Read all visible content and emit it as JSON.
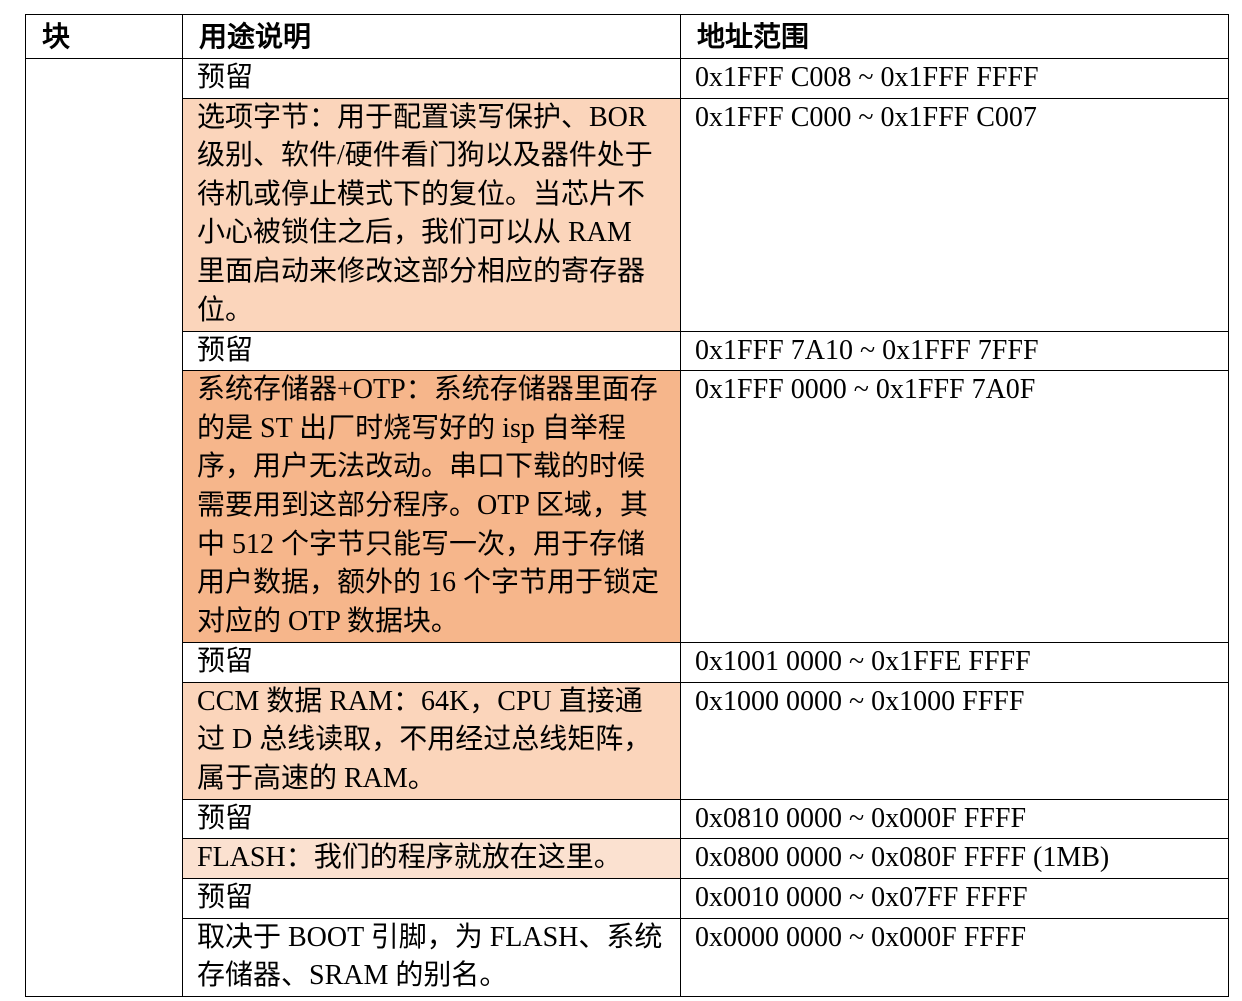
{
  "headers": {
    "block": "块",
    "purpose": "用途说明",
    "address": "地址范围"
  },
  "rows": [
    {
      "purpose": "预留",
      "address": "0x1FFF C008 ~ 0x1FFF FFFF",
      "shade": "none"
    },
    {
      "purpose": "选项字节：用于配置读写保护、BOR 级别、软件/硬件看门狗以及器件处于待机或停止模式下的复位。当芯片不小心被锁住之后，我们可以从 RAM 里面启动来修改这部分相应的寄存器位。",
      "address": "0x1FFF C000 ~ 0x1FFF C007",
      "shade": "light"
    },
    {
      "purpose": "预留",
      "address": "0x1FFF 7A10 ~ 0x1FFF 7FFF",
      "shade": "none"
    },
    {
      "purpose": "系统存储器+OTP：系统存储器里面存的是 ST 出厂时烧写好的 isp 自举程序，用户无法改动。串口下载的时候需要用到这部分程序。OTP 区域，其中 512 个字节只能写一次，用于存储用户数据，额外的 16 个字节用于锁定对应的 OTP 数据块。",
      "address": "0x1FFF 0000 ~ 0x1FFF 7A0F",
      "shade": "dark"
    },
    {
      "purpose": "预留",
      "address": "0x1001 0000 ~ 0x1FFE FFFF",
      "shade": "none"
    },
    {
      "purpose": "CCM 数据 RAM：64K，CPU 直接通过 D 总线读取，不用经过总线矩阵，属于高速的 RAM。",
      "address": "0x1000 0000 ~ 0x1000 FFFF",
      "shade": "light"
    },
    {
      "purpose": "预留",
      "address": "0x0810 0000 ~ 0x000F FFFF",
      "shade": "none"
    },
    {
      "purpose": "FLASH：我们的程序就放在这里。",
      "address": "0x0800 0000 ~ 0x080F FFFF (1MB)",
      "shade": "pale"
    },
    {
      "purpose": "预留",
      "address": "0x0010 0000 ~ 0x07FF FFFF",
      "shade": "none"
    },
    {
      "purpose": "取决于 BOOT 引脚，为 FLASH、系统存储器、SRAM 的别名。",
      "address": "0x0000 0000 ~ 0x000F FFFF",
      "shade": "none"
    }
  ],
  "colors": {
    "light_highlight": "#fbd5bb",
    "dark_highlight": "#f6b68b",
    "pale_highlight": "#fbe1d0",
    "border": "#000000"
  }
}
